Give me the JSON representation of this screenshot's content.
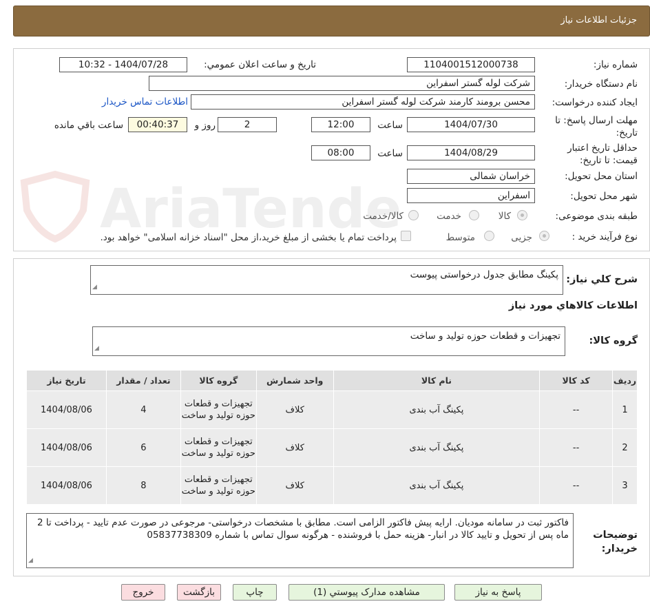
{
  "header": {
    "title": "جزئیات اطلاعات نیاز"
  },
  "form": {
    "need_number_label": "شماره نیاز:",
    "need_number": "1104001512000738",
    "announce_label": "تاریخ و ساعت اعلان عمومي:",
    "announce_value": "1404/07/28 - 10:32",
    "buyer_org_label": "نام دستگاه خریدار:",
    "buyer_org": "شرکت لوله گستر اسفراین",
    "requester_label": "ایجاد کننده درخواست:",
    "requester": "محسن برومند کارمند شرکت لوله گستر اسفراین",
    "contact_link": "اطلاعات تماس خریدار",
    "deadline_label": "مهلت ارسال پاسخ: تا تاریخ:",
    "deadline_date": "1404/07/30",
    "time_label": "ساعت",
    "deadline_time": "12:00",
    "days_value": "2",
    "days_label": "روز و",
    "remaining_time": "00:40:37",
    "remaining_label": "ساعت باقي مانده",
    "validity_label": "حداقل تاریخ اعتبار قیمت: تا تاریخ:",
    "validity_date": "1404/08/29",
    "validity_time": "08:00",
    "province_label": "استان محل تحویل:",
    "province": "خراسان شمالی",
    "city_label": "شهر محل تحویل:",
    "city": "اسفراین",
    "category_label": "طبقه بندی موضوعی:",
    "category_options": [
      "کالا",
      "خدمت",
      "کالا/خدمت"
    ],
    "process_label": "نوع فرآیند خرید :",
    "process_options": [
      "جزیی",
      "متوسط"
    ],
    "payment_note": "پرداخت تمام یا بخشی از مبلغ خرید،از محل \"اسناد خزانه اسلامی\" خواهد بود."
  },
  "summary": {
    "title_label": "شرح کلي نیاز:",
    "title_value": "پکینگ مطابق جدول درخواستی پیوست",
    "goods_info_heading": "اطلاعات کالاهاي مورد نیاز",
    "goods_group_label": "گروه کالا:",
    "goods_group_value": "تجهیزات و قطعات حوزه تولید و ساخت"
  },
  "table": {
    "headers": [
      "ردیف",
      "کد کالا",
      "نام کالا",
      "واحد شمارش",
      "گروه کالا",
      "تعداد / مقدار",
      "تاریخ نیاز"
    ],
    "rows": [
      {
        "row": "1",
        "code": "--",
        "name": "پکینگ آب بندی",
        "unit": "کلاف",
        "group": "تجهیزات و قطعات حوزه تولید و ساخت",
        "qty": "4",
        "date": "1404/08/06"
      },
      {
        "row": "2",
        "code": "--",
        "name": "پکینگ آب بندی",
        "unit": "کلاف",
        "group": "تجهیزات و قطعات حوزه تولید و ساخت",
        "qty": "6",
        "date": "1404/08/06"
      },
      {
        "row": "3",
        "code": "--",
        "name": "پکینگ آب بندی",
        "unit": "کلاف",
        "group": "تجهیزات و قطعات حوزه تولید و ساخت",
        "qty": "8",
        "date": "1404/08/06"
      }
    ]
  },
  "notes": {
    "label": "توضیحات خریدار:",
    "text": "فاکتور ثبت در سامانه مودیان. ارایه پیش فاکتور الزامی است. مطابق با مشخصات درخواستی- مرجوعی در صورت عدم تایید - پرداخت تا 2 ماه پس از تحویل و تایید کالا در انبار- هزینه حمل با فروشنده - هرگونه سوال تماس با شماره 05837738309"
  },
  "buttons": {
    "reply": "پاسخ به نیاز",
    "attachments": "مشاهده مدارک پیوستي (1)",
    "print": "چاپ",
    "back": "بازگشت",
    "exit": "خروج"
  },
  "watermark": {
    "text": "AriaTender.neT"
  },
  "colors": {
    "header_bg": "#8b6b3f",
    "link": "#1a55c5",
    "button_green": "#e6f5dd",
    "button_pink": "#fbdde0",
    "watermark": "#c0392b"
  }
}
